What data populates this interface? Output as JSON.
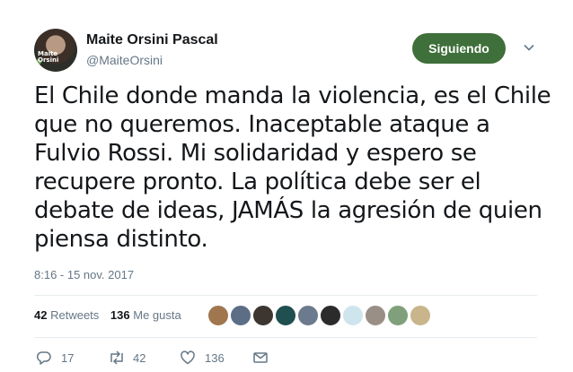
{
  "author": {
    "name": "Maite Orsini Pascal",
    "handle": "@MaiteOrsini",
    "avatar_text": [
      "Maite",
      "Orsini"
    ]
  },
  "follow_button": {
    "label": "Siguiendo",
    "color": "#3f6f3a"
  },
  "tweet": {
    "lines": [
      "El Chile donde manda la violencia, es el Chile",
      "que no queremos. Inaceptable ataque a",
      "Fulvio Rossi. Mi solidaridad y espero se",
      "recupere pronto. La política debe ser el",
      "debate de ideas, JAMÁS la agresión de quien",
      "piensa distinto."
    ],
    "timestamp": "8:16 - 15 nov. 2017"
  },
  "stats": {
    "retweets_count": "42",
    "retweets_label": "Retweets",
    "likes_count": "136",
    "likes_label": "Me gusta"
  },
  "liker_avatars": [
    {
      "name": "liker-avatar-1",
      "color": "#a0764e"
    },
    {
      "name": "liker-avatar-2",
      "color": "#5c6e86"
    },
    {
      "name": "liker-avatar-3",
      "color": "#3d3530"
    },
    {
      "name": "liker-avatar-4",
      "color": "#1f4f4f"
    },
    {
      "name": "liker-avatar-5",
      "color": "#6b7a8c"
    },
    {
      "name": "liker-avatar-6",
      "color": "#2b2b2b"
    },
    {
      "name": "liker-avatar-7",
      "color": "#cfe5ee"
    },
    {
      "name": "liker-avatar-8",
      "color": "#9a8f86"
    },
    {
      "name": "liker-avatar-9",
      "color": "#7fa07a"
    },
    {
      "name": "liker-avatar-10",
      "color": "#c9b58c"
    }
  ],
  "actions": {
    "reply_count": "17",
    "retweet_count": "42",
    "like_count": "136",
    "icons": [
      "reply-icon",
      "retweet-icon",
      "like-icon",
      "direct-message-icon"
    ]
  },
  "colors": {
    "text": "#14171a",
    "secondary": "#657786",
    "divider": "#e6ecf0"
  }
}
